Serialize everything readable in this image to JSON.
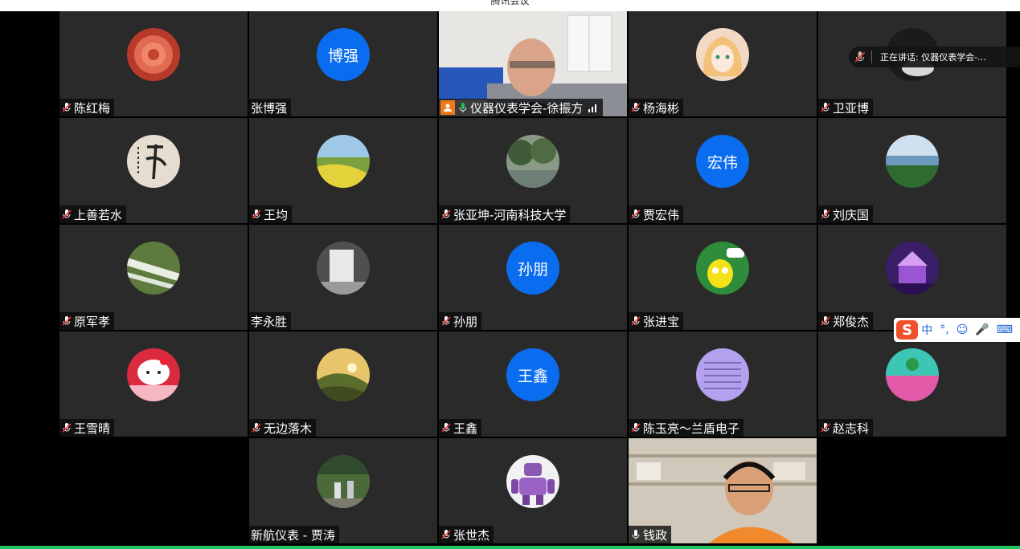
{
  "window": {
    "title": "腾讯会议"
  },
  "speaking_indicator": {
    "text": "正在讲话: 仪器仪表学会-..."
  },
  "ime_toolbar": {
    "items": [
      "中",
      "°,",
      "☺",
      "🎤",
      "⌨"
    ]
  },
  "participants": [
    {
      "name": "陈红梅",
      "avatar": "rose-avatar",
      "muted": true
    },
    {
      "name": "张博强",
      "avatar_text": "博强",
      "muted": false
    },
    {
      "name": "仪器仪表学会-徐振方",
      "avatar": "video-feed",
      "muted": false,
      "host": true,
      "active": true
    },
    {
      "name": "杨海彬",
      "avatar": "anime-girl-avatar",
      "muted": true
    },
    {
      "name": "卫亚博",
      "avatar": "dark-avatar",
      "muted": true
    },
    {
      "name": "上善若水",
      "avatar": "calligraphy-avatar",
      "muted": true
    },
    {
      "name": "王均",
      "avatar": "field-avatar",
      "muted": true
    },
    {
      "name": "张亚坤-河南科技大学",
      "avatar": "trees-avatar",
      "muted": true
    },
    {
      "name": "贾宏伟",
      "avatar_text": "宏伟",
      "muted": true
    },
    {
      "name": "刘庆国",
      "avatar": "lake-avatar",
      "muted": true
    },
    {
      "name": "原军孝",
      "avatar": "waterfall-avatar",
      "muted": true
    },
    {
      "name": "李永胜",
      "avatar": "falls-avatar",
      "muted": false
    },
    {
      "name": "孙朋",
      "avatar_text": "孙朋",
      "muted": true
    },
    {
      "name": "张进宝",
      "avatar": "cartoon-avatar",
      "muted": true
    },
    {
      "name": "郑俊杰",
      "avatar": "carousel-avatar",
      "muted": true
    },
    {
      "name": "王雪晴",
      "avatar": "hello-kitty-avatar",
      "muted": true
    },
    {
      "name": "无边落木",
      "avatar": "sunset-avatar",
      "muted": true
    },
    {
      "name": "王鑫",
      "avatar_text": "王鑫",
      "muted": true
    },
    {
      "name": "陈玉亮～兰盾电子",
      "avatar": "document-avatar",
      "muted": true
    },
    {
      "name": "赵志科",
      "avatar": "tulip-field-avatar",
      "muted": true
    },
    {
      "name": "新航仪表 - 贾涛",
      "avatar": "people-outdoor-avatar",
      "muted": false
    },
    {
      "name": "张世杰",
      "avatar": "robot-avatar",
      "muted": true
    },
    {
      "name": "钱政",
      "avatar": "video-feed",
      "muted": false
    }
  ],
  "colors": {
    "accent": "#0a6df0",
    "active_border": "#1fc35f",
    "tile_bg": "#2a2a2a"
  }
}
